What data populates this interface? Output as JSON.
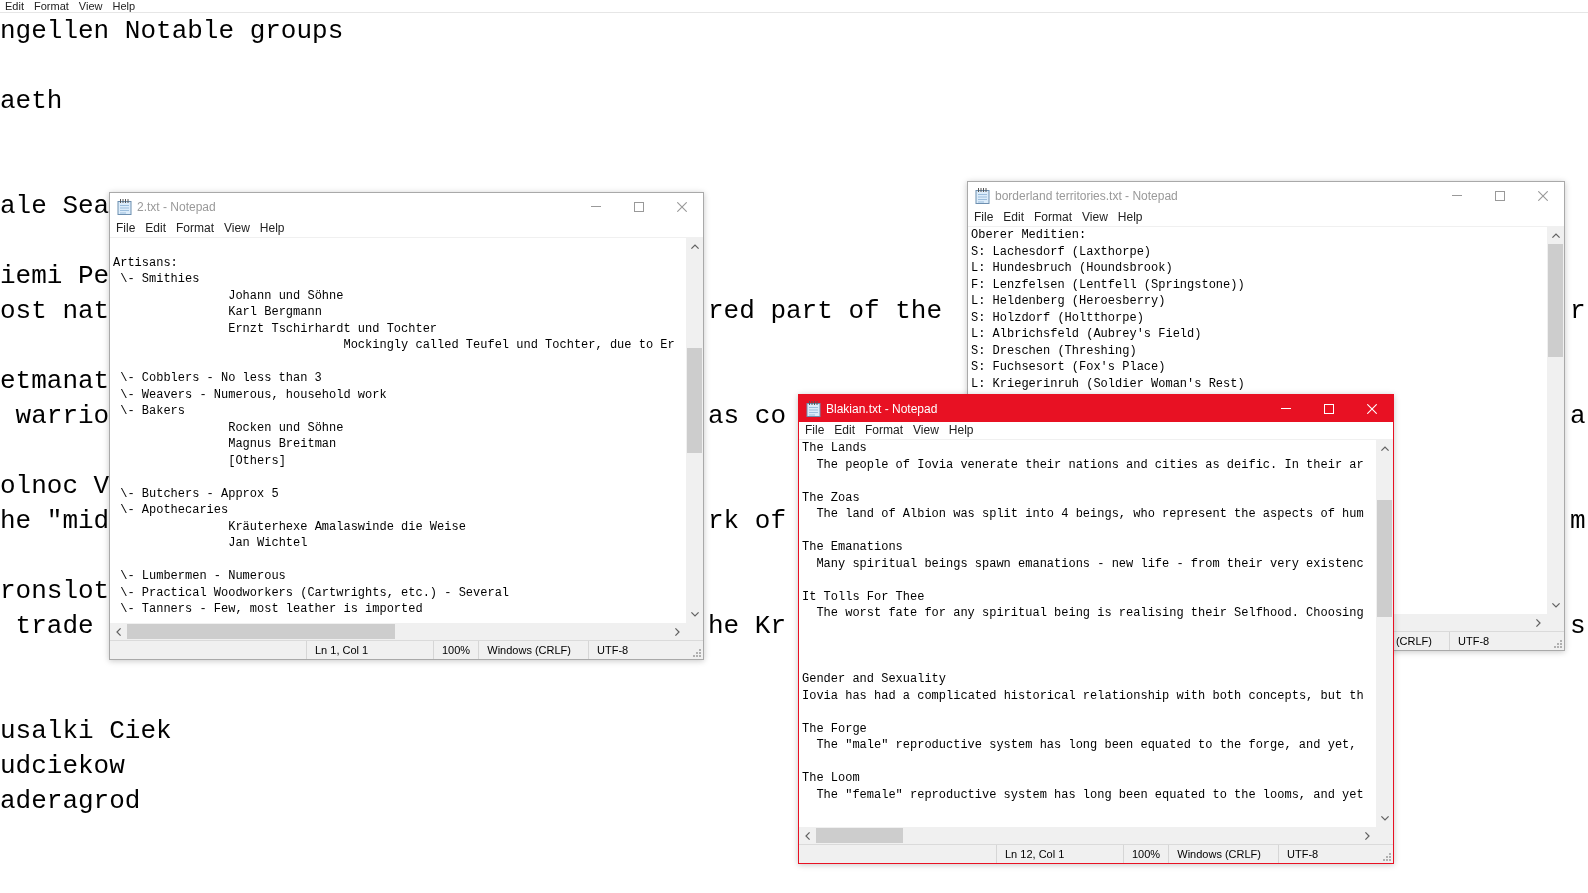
{
  "background": {
    "menu": [
      "Edit",
      "Format",
      "View",
      "Help"
    ],
    "lines": [
      {
        "kind": "text",
        "parts": [
          "ngellen Notable groups"
        ]
      },
      {
        "kind": "blank"
      },
      {
        "kind": "text",
        "parts": [
          "aeth"
        ]
      },
      {
        "kind": "blank"
      },
      {
        "kind": "blank"
      },
      {
        "kind": "text",
        "parts": [
          "ale Sea"
        ]
      },
      {
        "kind": "blank"
      },
      {
        "kind": "text",
        "parts": [
          "iemi Pe"
        ]
      },
      {
        "kind": "text",
        "parts": [
          "ost nat",
          "red part of the",
          "r"
        ]
      },
      {
        "kind": "blank"
      },
      {
        "kind": "text",
        "parts": [
          "etmanat"
        ]
      },
      {
        "kind": "text",
        "parts": [
          " warrio",
          "as co",
          "a"
        ]
      },
      {
        "kind": "blank"
      },
      {
        "kind": "text",
        "parts": [
          "olnoc V"
        ]
      },
      {
        "kind": "text",
        "parts": [
          "he \"mid",
          "rk of",
          "m"
        ]
      },
      {
        "kind": "blank"
      },
      {
        "kind": "text",
        "parts": [
          "ronslot"
        ]
      },
      {
        "kind": "text",
        "parts": [
          " trade",
          "he Kr",
          "s"
        ]
      },
      {
        "kind": "blank"
      },
      {
        "kind": "blank"
      },
      {
        "kind": "text",
        "parts": [
          "usalki Ciek"
        ]
      },
      {
        "kind": "text",
        "parts": [
          "udciekow"
        ]
      },
      {
        "kind": "text",
        "parts": [
          "aderagrod"
        ]
      }
    ]
  },
  "windows": [
    {
      "title": "2.txt - Notepad",
      "active": false,
      "menu": [
        "File",
        "Edit",
        "Format",
        "View",
        "Help"
      ],
      "lines": [
        {
          "kind": "blank"
        },
        {
          "kind": "text",
          "text": "Artisans:",
          "children": [
            {
              "kind": "text",
              "text": "\\- Smithies",
              "children": [
                {
                  "kind": "text",
                  "text": "Johann und Söhne"
                },
                {
                  "kind": "text",
                  "text": "Karl Bergmann"
                },
                {
                  "kind": "text",
                  "text": "Ernzt Tschirhardt und Tochter",
                  "children": [
                    {
                      "kind": "text",
                      "text": "Mockingly called Teufel und Tochter, due to Er"
                    }
                  ]
                }
              ]
            },
            {
              "kind": "blank"
            },
            {
              "kind": "text",
              "text": "\\- Cobblers - No less than 3"
            },
            {
              "kind": "text",
              "text": "\\- Weavers - Numerous, household work"
            },
            {
              "kind": "text",
              "text": "\\- Bakers",
              "children": [
                {
                  "kind": "text",
                  "text": "Rocken und Söhne"
                },
                {
                  "kind": "text",
                  "text": "Magnus Breitman"
                },
                {
                  "kind": "text",
                  "text": "[Others]"
                }
              ]
            },
            {
              "kind": "blank"
            },
            {
              "kind": "text",
              "text": "\\- Butchers - Approx 5"
            },
            {
              "kind": "text",
              "text": "\\- Apothecaries",
              "children": [
                {
                  "kind": "text",
                  "text": "Kräuterhexe Amalaswinde die Weise"
                },
                {
                  "kind": "text",
                  "text": "Jan Wichtel"
                }
              ]
            },
            {
              "kind": "blank"
            },
            {
              "kind": "text",
              "text": "\\- Lumbermen - Numerous"
            },
            {
              "kind": "text",
              "text": "\\- Practical Woodworkers (Cartwrights, etc.) - Several"
            },
            {
              "kind": "text",
              "text": "\\- Tanners - Few, most leather is imported"
            }
          ]
        }
      ],
      "status_bar": [
        "Ln 1, Col 1",
        "100%",
        "Windows (CRLF)",
        "UTF-8"
      ]
    },
    {
      "title": "borderland territories.txt - Notepad",
      "active": false,
      "menu": [
        "File",
        "Edit",
        "Format",
        "View",
        "Help"
      ],
      "lines": [
        {
          "kind": "text",
          "text": "Oberer Meditien:"
        },
        {
          "kind": "text",
          "text": "S: Lachesdorf (Laxthorpe)"
        },
        {
          "kind": "text",
          "text": "L: Hundesbruch (Houndsbrook)"
        },
        {
          "kind": "text",
          "text": "F: Lenzfelsen (Lentfell (Springstone))"
        },
        {
          "kind": "text",
          "text": "L: Heldenberg (Heroesberry)"
        },
        {
          "kind": "text",
          "text": "S: Holzdorf (Holtthorpe)"
        },
        {
          "kind": "text",
          "text": "L: Albrichsfeld (Aubrey's Field)"
        },
        {
          "kind": "text",
          "text": "S: Dreschen (Threshing)"
        },
        {
          "kind": "text",
          "text": "S: Fuchsesort (Fox's Place)"
        },
        {
          "kind": "text",
          "text": "L: Kriegerinruh (Soldier Woman's Rest)"
        }
      ],
      "status_bar": [
        "(CRLF)",
        "UTF-8"
      ]
    },
    {
      "title": "Blakian.txt - Notepad",
      "active": true,
      "menu": [
        "File",
        "Edit",
        "Format",
        "View",
        "Help"
      ],
      "lines": [
        {
          "kind": "text",
          "text": "The Lands",
          "children": [
            {
              "kind": "text",
              "text": "The people of Iovia venerate their nations and cities as deific. In their ar"
            }
          ]
        },
        {
          "kind": "blank"
        },
        {
          "kind": "text",
          "text": "The Zoas",
          "children": [
            {
              "kind": "text",
              "text": "The land of Albion was split into 4 beings, who represent the aspects of hum"
            }
          ]
        },
        {
          "kind": "blank"
        },
        {
          "kind": "text",
          "text": "The Emanations",
          "children": [
            {
              "kind": "text",
              "text": "Many spiritual beings spawn emanations - new life - from their very existenc"
            }
          ]
        },
        {
          "kind": "blank"
        },
        {
          "kind": "text",
          "text": "It Tolls For Thee",
          "children": [
            {
              "kind": "text",
              "text": "The worst fate for any spiritual being is realising their Selfhood. Choosing"
            }
          ]
        },
        {
          "kind": "blank"
        },
        {
          "kind": "blank"
        },
        {
          "kind": "blank"
        },
        {
          "kind": "text",
          "text": "Gender and Sexuality"
        },
        {
          "kind": "text",
          "text": "Iovia has had a complicated historical relationship with both concepts, but th"
        },
        {
          "kind": "blank"
        },
        {
          "kind": "text",
          "text": "The Forge",
          "children": [
            {
              "kind": "text",
              "text": "The \"male\" reproductive system has long been equated to the forge, and yet,"
            }
          ]
        },
        {
          "kind": "blank"
        },
        {
          "kind": "text",
          "text": "The Loom",
          "children": [
            {
              "kind": "text",
              "text": "The \"female\" reproductive system has long been equated to the looms, and yet"
            }
          ]
        }
      ],
      "status_bar": [
        "Ln 12, Col 1",
        "100%",
        "Windows (CRLF)",
        "UTF-8"
      ]
    }
  ]
}
